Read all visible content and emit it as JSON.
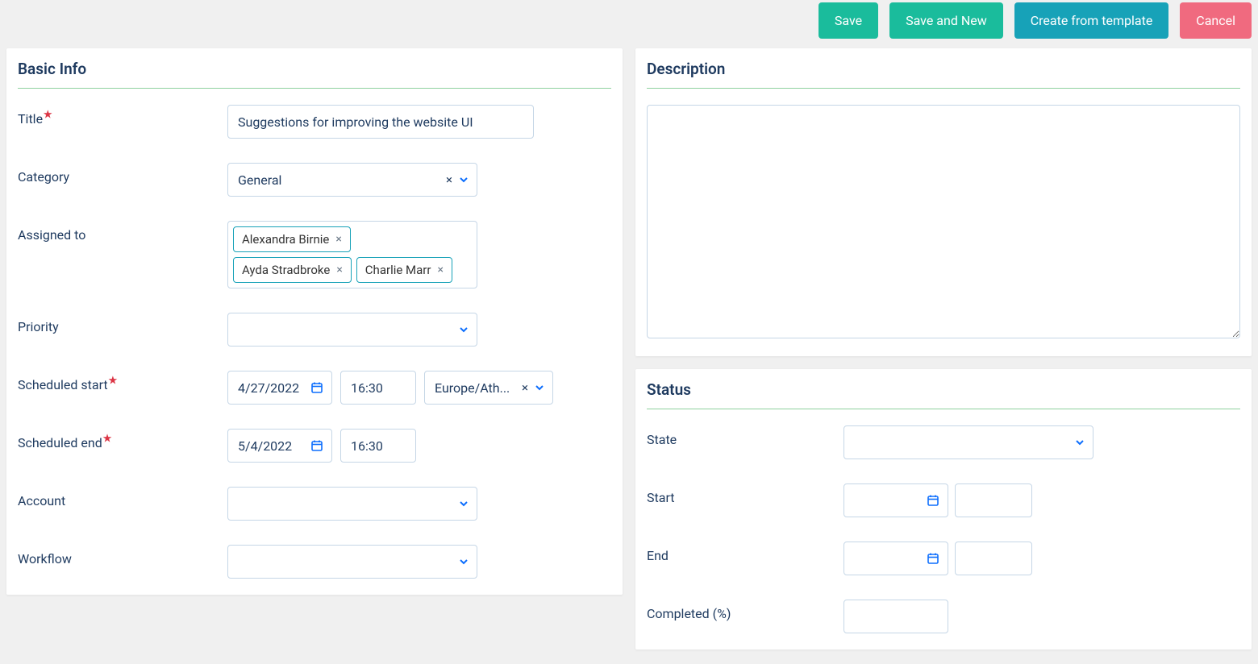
{
  "toolbar": {
    "save": "Save",
    "save_new": "Save and New",
    "create_template": "Create from template",
    "cancel": "Cancel"
  },
  "panels": {
    "basic_info": {
      "title": "Basic Info",
      "fields": {
        "title": {
          "label": "Title",
          "value": "Suggestions for improving the website UI"
        },
        "category": {
          "label": "Category",
          "value": "General"
        },
        "assigned_to": {
          "label": "Assigned to",
          "tags": [
            "Alexandra Birnie",
            "Ayda Stradbroke",
            "Charlie Marr"
          ]
        },
        "priority": {
          "label": "Priority",
          "value": ""
        },
        "scheduled_start": {
          "label": "Scheduled start",
          "date": "4/27/2022",
          "time": "16:30",
          "tz": "Europe/Ath..."
        },
        "scheduled_end": {
          "label": "Scheduled end",
          "date": "5/4/2022",
          "time": "16:30"
        },
        "account": {
          "label": "Account",
          "value": ""
        },
        "workflow": {
          "label": "Workflow",
          "value": ""
        }
      }
    },
    "description": {
      "title": "Description",
      "value": ""
    },
    "status": {
      "title": "Status",
      "fields": {
        "state": {
          "label": "State",
          "value": ""
        },
        "start": {
          "label": "Start",
          "date": "",
          "time": ""
        },
        "end": {
          "label": "End",
          "date": "",
          "time": ""
        },
        "completed": {
          "label": "Completed (%)",
          "value": ""
        }
      }
    }
  }
}
